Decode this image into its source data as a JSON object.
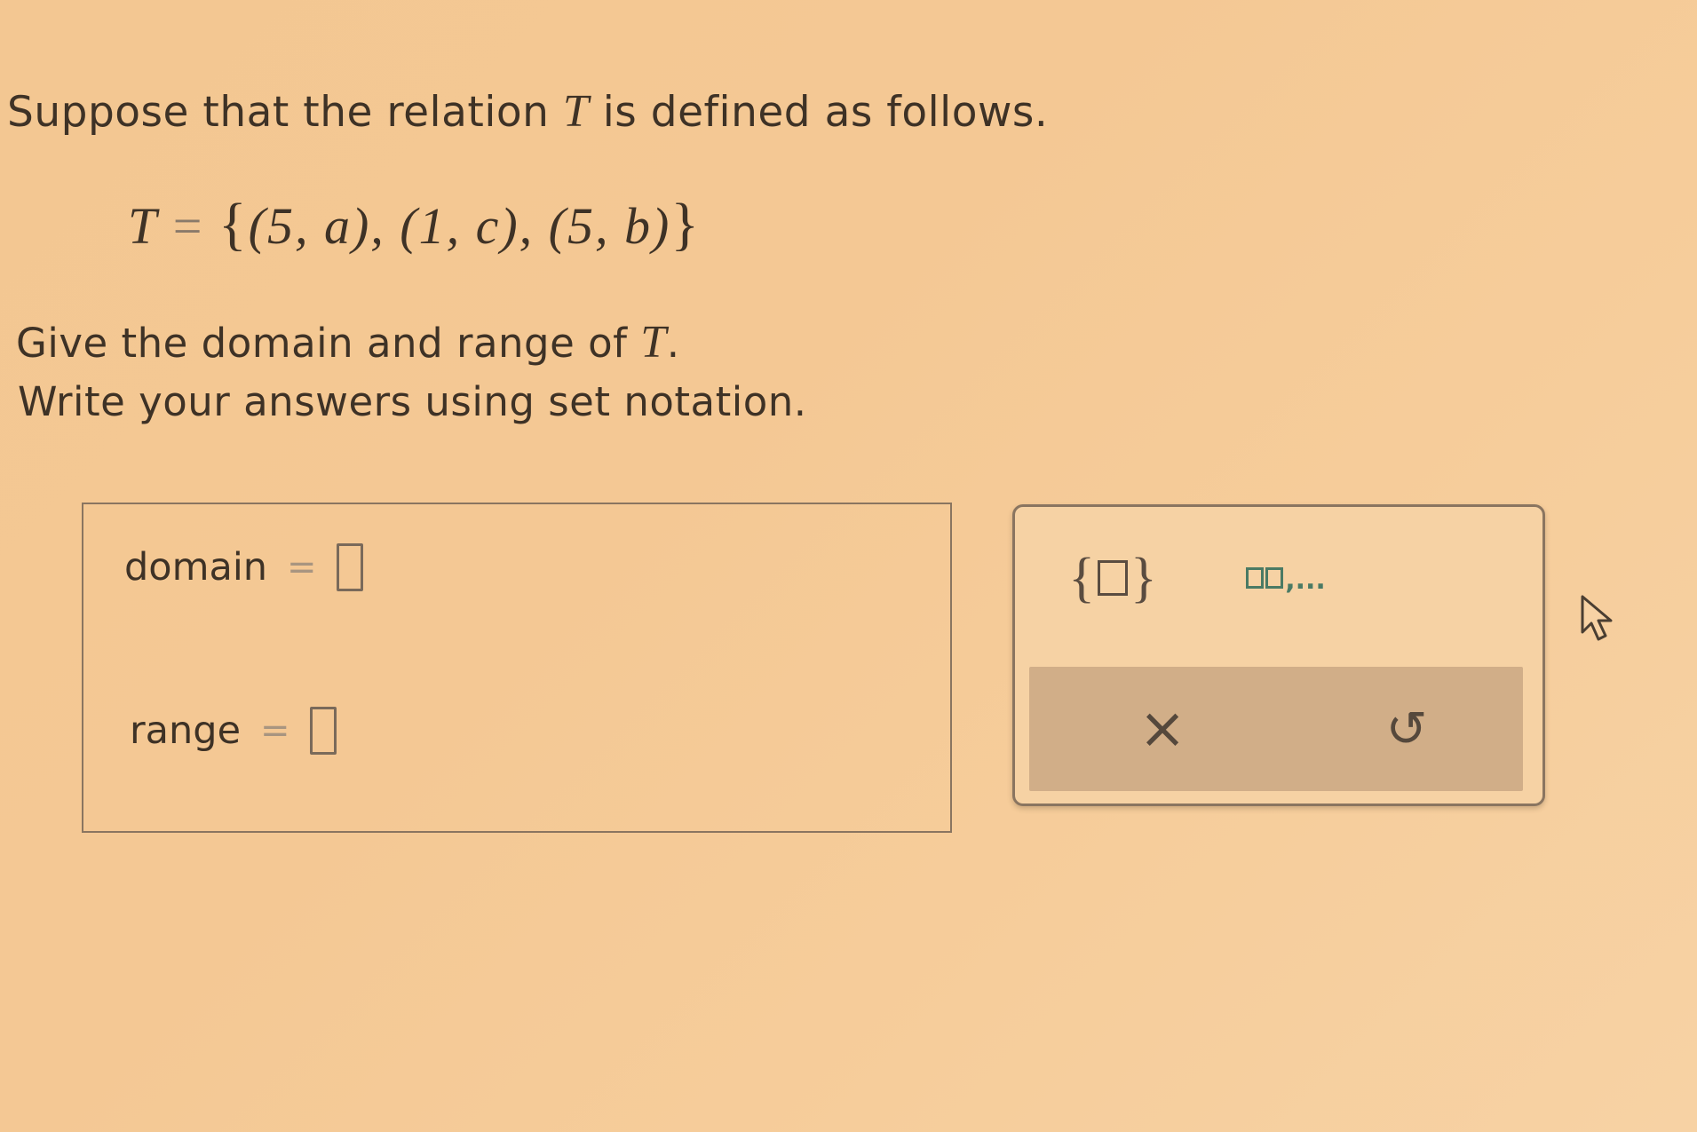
{
  "question": {
    "prompt_before": "Suppose that the relation ",
    "relation_var": "T",
    "prompt_after": " is defined as follows.",
    "equation": {
      "lhs": "T",
      "equals": "=",
      "open_brace": "{",
      "pairs_text": "(5, a), (1, c), (5, b)",
      "close_brace": "}"
    },
    "instruction1_before": "Give the domain and range of ",
    "instruction1_var": "T",
    "instruction1_after": ".",
    "instruction2": "Write your answers using set notation."
  },
  "answer": {
    "domain_label": "domain",
    "domain_value": "",
    "range_label": "range",
    "range_value": "",
    "equals": "="
  },
  "palette": {
    "set_button_icon": "set-braces-icon",
    "list_button_icon": "list-elements-icon",
    "list_button_suffix": ",...",
    "clear_button_icon": "close-icon",
    "clear_symbol": "×",
    "undo_button_icon": "undo-icon",
    "undo_symbol": "↺"
  },
  "colors": {
    "background": "#f4c894",
    "accent_green": "#4a7a64",
    "action_bar": "#d1ae88"
  }
}
